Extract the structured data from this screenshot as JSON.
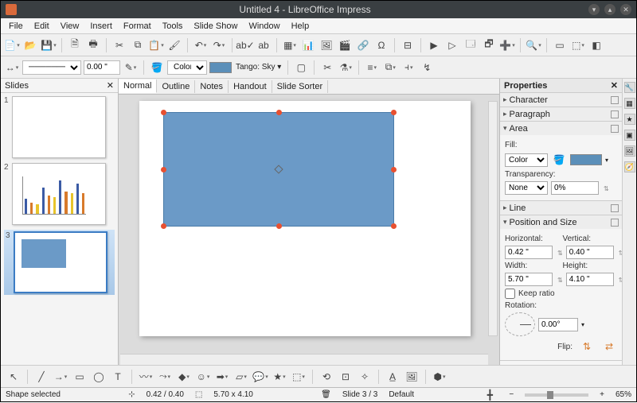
{
  "window": {
    "title": "Untitled 4 - LibreOffice Impress"
  },
  "menus": [
    "File",
    "Edit",
    "View",
    "Insert",
    "Format",
    "Tools",
    "Slide Show",
    "Window",
    "Help"
  ],
  "toolbar2": {
    "line_width": "0.00 \"",
    "fill_mode_label": "Color",
    "color_name": "Tango: Sky ▾"
  },
  "slides_panel": {
    "title": "Slides"
  },
  "view_tabs": [
    "Normal",
    "Outline",
    "Notes",
    "Handout",
    "Slide Sorter"
  ],
  "active_view_tab": 0,
  "properties": {
    "title": "Properties",
    "character": "Character",
    "paragraph": "Paragraph",
    "area": "Area",
    "fill_label": "Fill:",
    "fill_mode": "Color",
    "transparency_label": "Transparency:",
    "transparency_mode": "None",
    "transparency_value": "0%",
    "line": "Line",
    "pos_size": "Position and Size",
    "horizontal_label": "Horizontal:",
    "vertical_label": "Vertical:",
    "horizontal": "0.42 \"",
    "vertical": "0.40 \"",
    "width_label": "Width:",
    "height_label": "Height:",
    "width": "5.70 \"",
    "height": "4.10 \"",
    "keep_ratio": "Keep ratio",
    "rotation_label": "Rotation:",
    "rotation": "0.00°",
    "flip_label": "Flip:"
  },
  "status": {
    "selection": "Shape selected",
    "position": "0.42 / 0.40",
    "size": "5.70 x 4.10",
    "slide": "Slide 3 / 3",
    "layout": "Default",
    "zoom": "65%"
  },
  "shape": {
    "fill_color": "#6b9ac7"
  }
}
